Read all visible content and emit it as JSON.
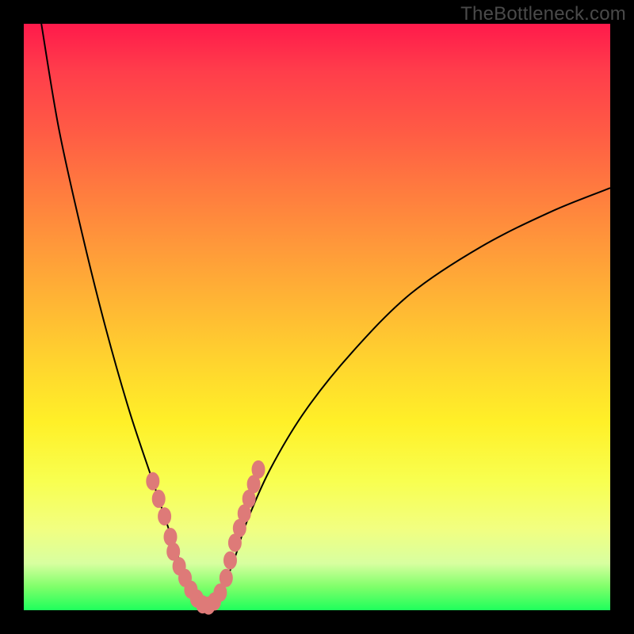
{
  "watermark": "TheBottleneck.com",
  "colors": {
    "background": "#000000",
    "gradient_top": "#ff1a4b",
    "gradient_bottom": "#1eff5c",
    "curve": "#000000",
    "marker": "#de7a78"
  },
  "chart_data": {
    "type": "line",
    "title": "",
    "xlabel": "",
    "ylabel": "",
    "xlim": [
      0,
      100
    ],
    "ylim": [
      0,
      100
    ],
    "series": [
      {
        "name": "bottleneck-curve",
        "x": [
          3,
          6,
          10,
          14,
          18,
          22,
          24,
          26,
          27.5,
          29,
          30,
          31,
          32,
          34,
          36,
          38,
          42,
          48,
          56,
          66,
          78,
          90,
          100
        ],
        "y": [
          100,
          82,
          64,
          48,
          34,
          22,
          16,
          10,
          6,
          3,
          1.2,
          0.8,
          1.5,
          4,
          9,
          15,
          24,
          34,
          44,
          54,
          62,
          68,
          72
        ]
      }
    ],
    "markers": {
      "name": "highlight-points",
      "x": [
        22,
        23,
        24,
        25,
        25.5,
        26.5,
        27.5,
        28.5,
        29.5,
        30.5,
        31.5,
        32.5,
        33.5,
        34.5,
        35.2,
        36,
        36.8,
        37.6,
        38.4,
        39.2,
        40
      ],
      "y": [
        22,
        19,
        16,
        12.5,
        10,
        7.5,
        5.5,
        3.5,
        2,
        1.0,
        0.8,
        1.5,
        3,
        5.5,
        8.5,
        11.5,
        14,
        16.5,
        19,
        21.5,
        24
      ]
    }
  }
}
